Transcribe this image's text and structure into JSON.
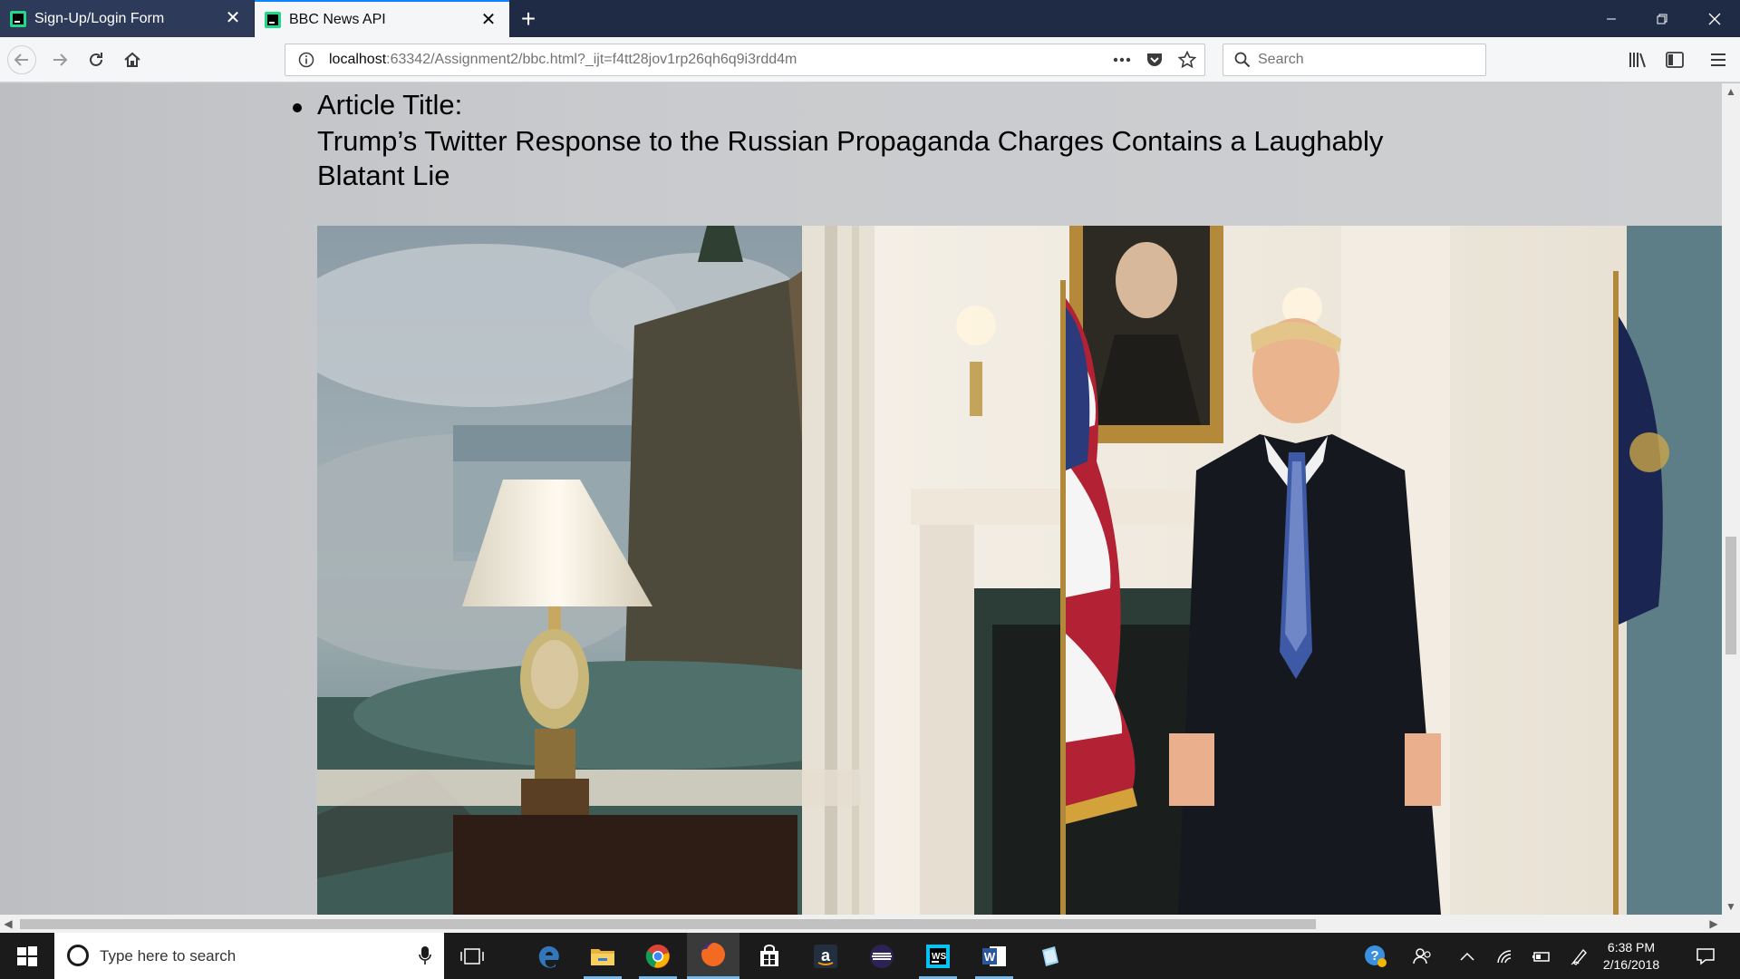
{
  "browser": {
    "tabs": [
      {
        "title": "Sign-Up/Login Form",
        "active": false
      },
      {
        "title": "BBC News API",
        "active": true
      }
    ],
    "new_tab_label": "+",
    "url_host": "localhost",
    "url_path": ":63342/Assignment2/bbc.html?_ijt=f4tt28jov1rp26qh6q9i3rdd4m",
    "search_placeholder": "Search",
    "accent_color": "#0a84ff"
  },
  "page": {
    "article": {
      "label": "Article Title:",
      "title": "Trump’s Twitter Response to the Russian Propaganda Charges Contains a Laughably Blatant Lie"
    }
  },
  "taskbar": {
    "search_placeholder": "Type here to search",
    "apps": [
      "task-view",
      "edge",
      "file-explorer",
      "chrome",
      "firefox",
      "store",
      "amazon",
      "eclipse",
      "webstorm",
      "word",
      "notepad"
    ],
    "clock_time": "6:38 PM",
    "clock_date": "2/16/2018"
  }
}
